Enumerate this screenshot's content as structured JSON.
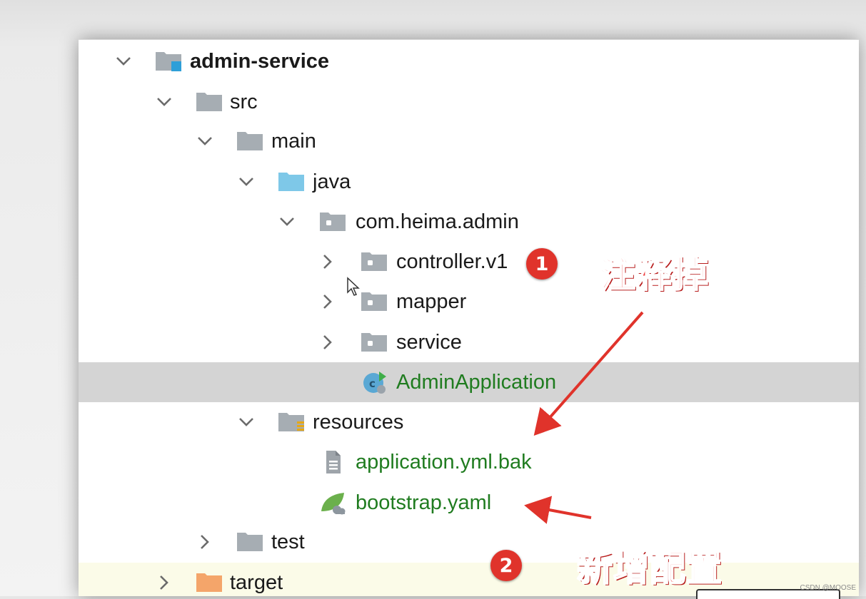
{
  "tree": {
    "items": [
      {
        "label": "admin-service",
        "expanded": true,
        "icon": "module-folder-icon"
      },
      {
        "label": "src",
        "expanded": true,
        "icon": "folder-icon"
      },
      {
        "label": "main",
        "expanded": true,
        "icon": "folder-icon"
      },
      {
        "label": "java",
        "expanded": true,
        "icon": "source-root-folder-icon"
      },
      {
        "label": "com.heima.admin",
        "expanded": true,
        "icon": "package-icon"
      },
      {
        "label": "controller.v1",
        "expanded": false,
        "icon": "package-icon"
      },
      {
        "label": "mapper",
        "expanded": false,
        "icon": "package-icon"
      },
      {
        "label": "service",
        "expanded": false,
        "icon": "package-icon"
      },
      {
        "label": "AdminApplication",
        "selected": true,
        "icon": "spring-boot-class-icon"
      },
      {
        "label": "resources",
        "expanded": true,
        "icon": "resources-folder-icon"
      },
      {
        "label": "application.yml.bak",
        "icon": "text-file-icon"
      },
      {
        "label": "bootstrap.yaml",
        "icon": "spring-config-file-icon"
      },
      {
        "label": "test",
        "expanded": false,
        "icon": "folder-icon"
      },
      {
        "label": "target",
        "expanded": false,
        "icon": "excluded-folder-icon"
      }
    ]
  },
  "annotations": {
    "badge1": "1",
    "badge2": "2",
    "note1": "注释掉",
    "note2": "新增配置"
  },
  "watermark": "CSDN @MOOSE",
  "colors": {
    "file_green": "#207c20",
    "selection": "#d4d4d4",
    "annotation_red": "#e0332b",
    "source_root_blue": "#7ec8e8",
    "excluded_orange": "#f4a56a"
  }
}
